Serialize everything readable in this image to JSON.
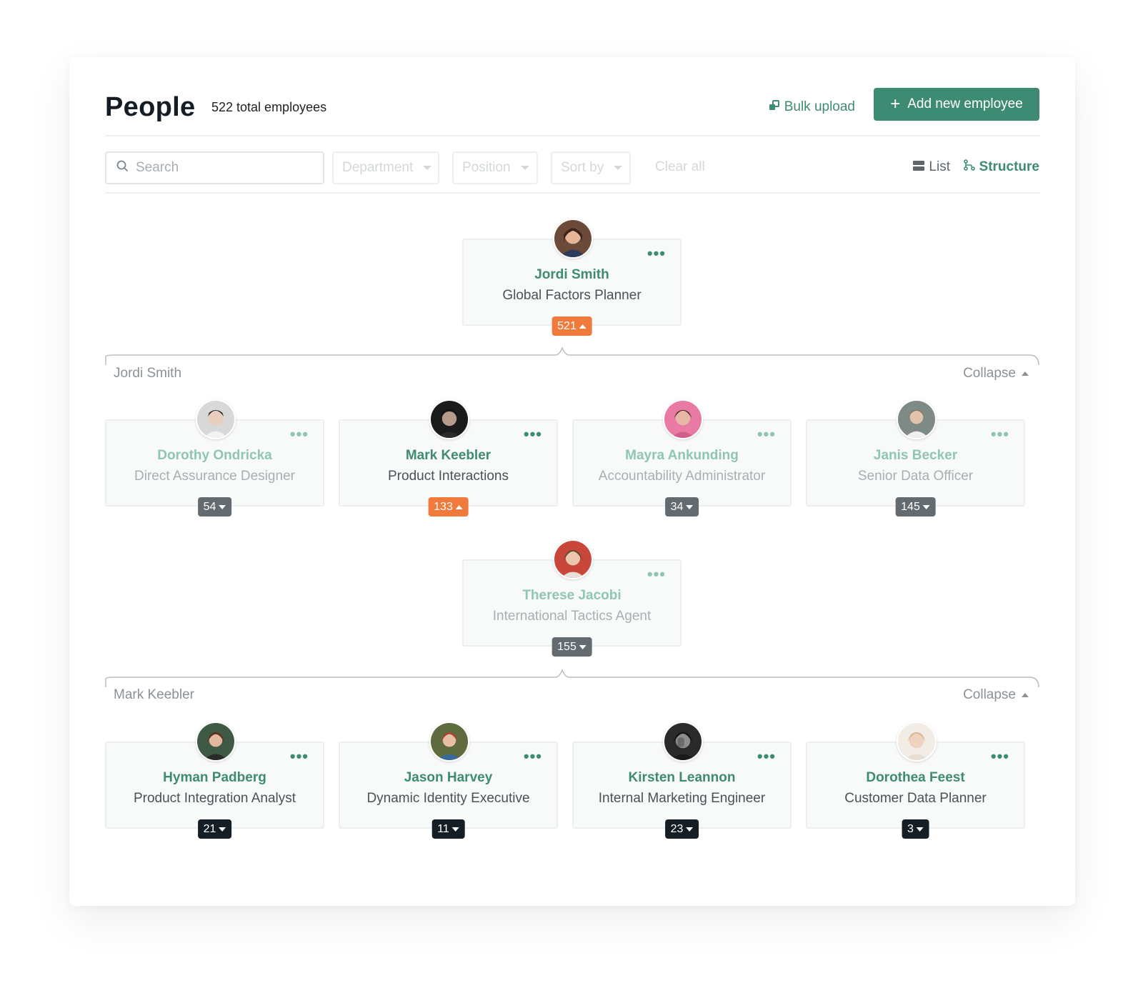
{
  "header": {
    "title": "People",
    "total": "522 total employees",
    "bulk_upload": "Bulk upload",
    "add_button": "Add new employee"
  },
  "filters": {
    "search_placeholder": "Search",
    "department": "Department",
    "position": "Position",
    "sort_by": "Sort by",
    "clear_all": "Clear all",
    "view_list": "List",
    "view_structure": "Structure",
    "active_view": "Structure"
  },
  "colors": {
    "accent": "#3e8b73",
    "badge_expanded": "#f07a3b",
    "badge_collapsed_inactive": "#636b71",
    "badge_collapsed_leaf": "#151d25"
  },
  "root": {
    "name": "Jordi Smith",
    "role": "Global Factors Planner",
    "count": "521",
    "expanded": true
  },
  "groups": [
    {
      "label": "Jordi Smith",
      "collapse": "Collapse",
      "members": [
        {
          "name": "Dorothy Ondricka",
          "role": "Direct Assurance Designer",
          "count": "54",
          "expanded": false,
          "faded": true
        },
        {
          "name": "Mark Keebler",
          "role": "Product Interactions",
          "count": "133",
          "expanded": true,
          "faded": false
        },
        {
          "name": "Mayra Ankunding",
          "role": "Accountability Administrator",
          "count": "34",
          "expanded": false,
          "faded": true
        },
        {
          "name": "Janis Becker",
          "role": "Senior Data Officer",
          "count": "145",
          "expanded": false,
          "faded": true
        },
        {
          "name": "Therese Jacobi",
          "role": "International Tactics Agent",
          "count": "155",
          "expanded": false,
          "faded": true
        }
      ]
    },
    {
      "label": "Mark Keebler",
      "collapse": "Collapse",
      "members": [
        {
          "name": "Hyman Padberg",
          "role": "Product Integration Analyst",
          "count": "21",
          "expanded": false,
          "faded": false
        },
        {
          "name": "Jason Harvey",
          "role": "Dynamic Identity Executive",
          "count": "11",
          "expanded": false,
          "faded": false
        },
        {
          "name": "Kirsten Leannon",
          "role": "Internal Marketing Engineer",
          "count": "23",
          "expanded": false,
          "faded": false
        },
        {
          "name": "Dorothea Feest",
          "role": "Customer Data Planner",
          "count": "3",
          "expanded": false,
          "faded": false
        }
      ]
    }
  ]
}
